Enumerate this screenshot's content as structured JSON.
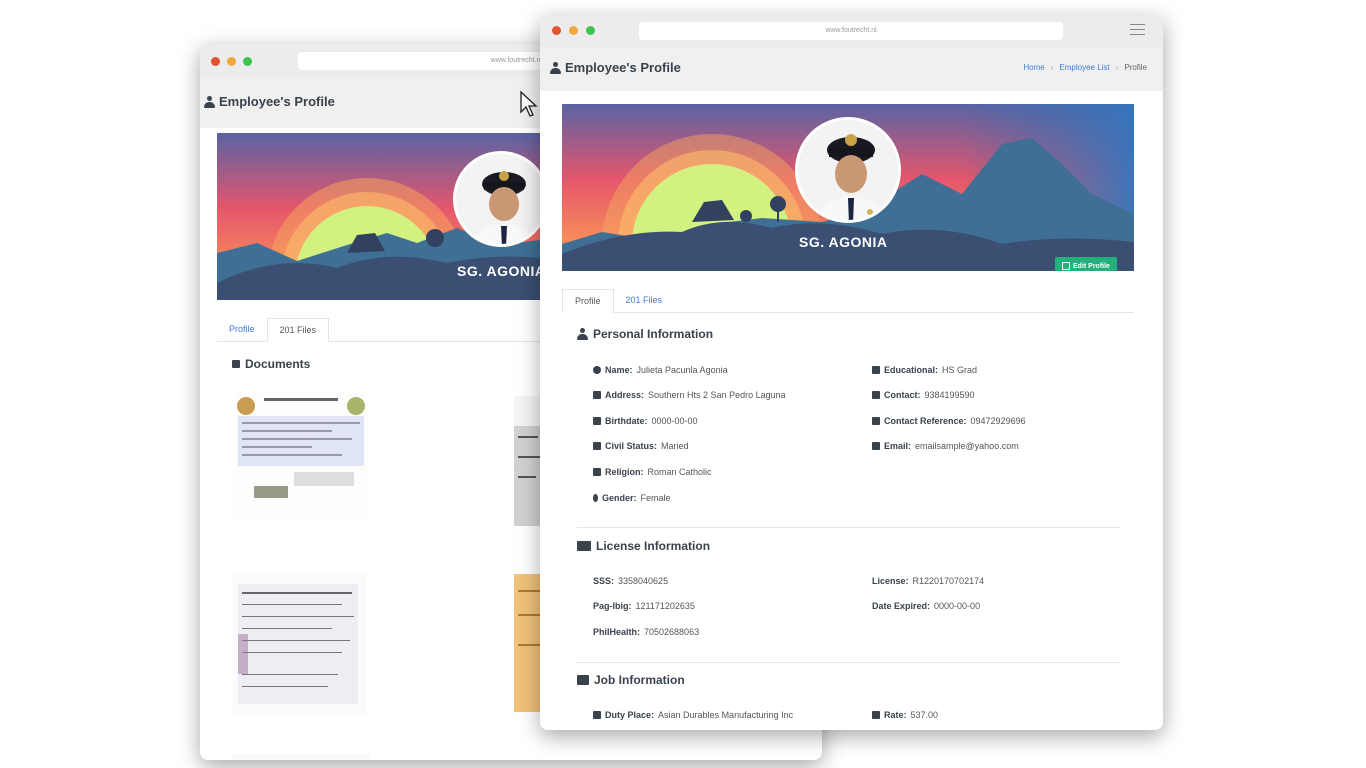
{
  "back_window": {
    "url": "www.foutrecht.nl",
    "page_title": "Employee's Profile",
    "banner_name": "SG. AGONIA",
    "tabs": [
      {
        "label": "Profile"
      },
      {
        "label": "201 Files"
      }
    ],
    "documents_title": "Documents"
  },
  "front_window": {
    "url": "www.foutrecht.nl",
    "page_title": "Employee's Profile",
    "breadcrumb": [
      "Home",
      "Employee List",
      "Profile"
    ],
    "banner_name": "SG. AGONIA",
    "edit_button": "Edit Profile",
    "tabs": [
      {
        "label": "Profile"
      },
      {
        "label": "201 Files"
      }
    ],
    "personal": {
      "title": "Personal Information",
      "left": [
        {
          "label": "Name:",
          "value": "Julieta Pacunla Agonia",
          "icon": "user-icon"
        },
        {
          "label": "Address:",
          "value": "Southern Hts 2 San Pedro Laguna",
          "icon": "home-icon"
        },
        {
          "label": "Birthdate:",
          "value": "0000-00-00",
          "icon": "calendar-icon"
        },
        {
          "label": "Civil Status:",
          "value": "Maried",
          "icon": "file-icon"
        },
        {
          "label": "Religion:",
          "value": "Roman Catholic",
          "icon": "church-icon"
        },
        {
          "label": "Gender:",
          "value": "Female",
          "icon": "female-icon"
        }
      ],
      "right": [
        {
          "label": "Educational:",
          "value": "HS Grad",
          "icon": "graduation-cap-icon"
        },
        {
          "label": "Contact:",
          "value": "9384199590",
          "icon": "phone-icon"
        },
        {
          "label": "Contact Reference:",
          "value": "09472929696",
          "icon": "phone-icon"
        },
        {
          "label": "Email:",
          "value": "emailsample@yahoo.com",
          "icon": "envelope-icon"
        }
      ]
    },
    "license": {
      "title": "License Information",
      "left": [
        {
          "label": "SSS:",
          "value": "3358040625"
        },
        {
          "label": "Pag-Ibig:",
          "value": "121171202635"
        },
        {
          "label": "PhilHealth:",
          "value": "70502688063"
        }
      ],
      "right": [
        {
          "label": "License:",
          "value": "R1220170702174"
        },
        {
          "label": "Date Expired:",
          "value": "0000-00-00"
        }
      ]
    },
    "job": {
      "title": "Job Information",
      "left": [
        {
          "label": "Duty Place:",
          "value": "Asian Durables Manufacturing Inc",
          "icon": "map-icon"
        }
      ],
      "right": [
        {
          "label": "Rate:",
          "value": "537.00",
          "icon": "calendar-icon"
        }
      ]
    }
  },
  "colors": {
    "link": "#3b7ddd",
    "edit_button": "#22b07d",
    "sky_top": "#5566a6",
    "sky_mid": "#e8536a",
    "sun": "#d4f27e",
    "hills": "#3f6f95"
  }
}
